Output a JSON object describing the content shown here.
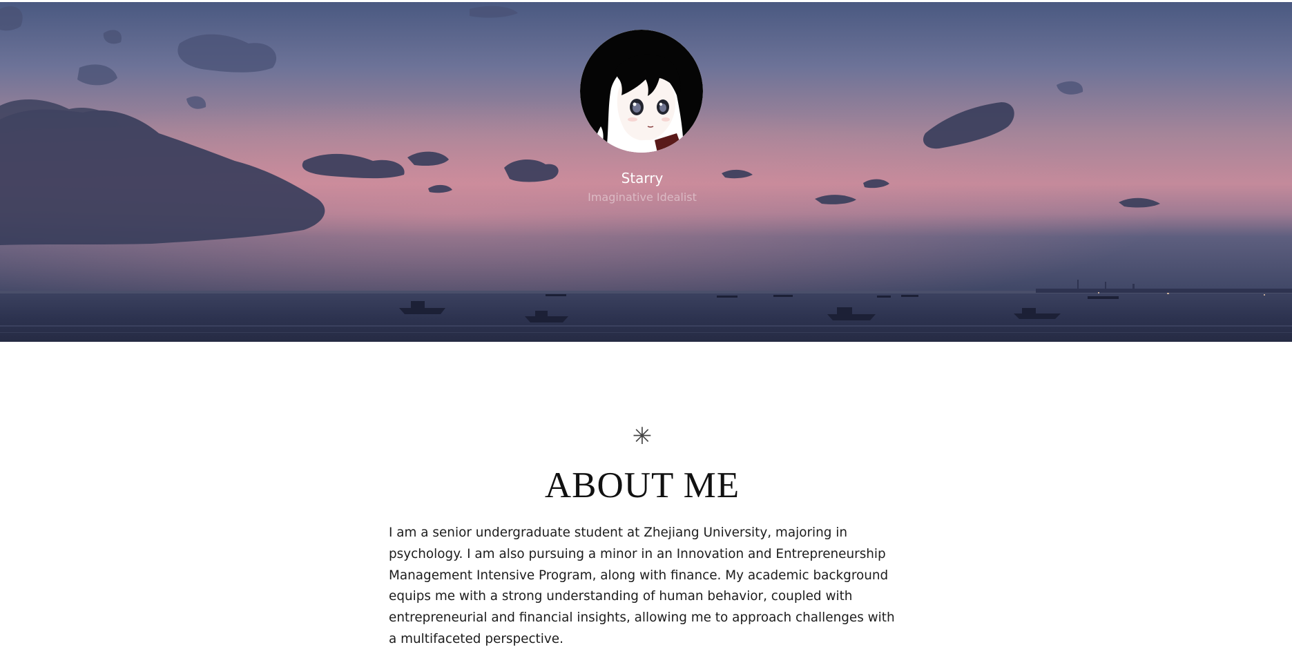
{
  "profile": {
    "name": "Starry",
    "tagline": "Imaginative Idealist",
    "avatar_icon": "anime-girl-avatar"
  },
  "about": {
    "icon": "asterisk-icon",
    "icon_glyph": "✳",
    "title": "ABOUT ME",
    "text": "I am a senior undergraduate student at Zhejiang University, majoring in psychology. I am also pursuing a minor in an Innovation and Entrepreneurship Management Intensive Program, along with finance. My academic background equips me with a strong understanding of human behavior, coupled with entrepreneurial and financial insights, allowing me to approach challenges with a multifaceted perspective."
  },
  "colors": {
    "sky_top": "#4d5c85",
    "sky_glow": "#c88a9c",
    "sea": "#2a3049",
    "text": "#1c1c1c",
    "title": "#111111"
  }
}
